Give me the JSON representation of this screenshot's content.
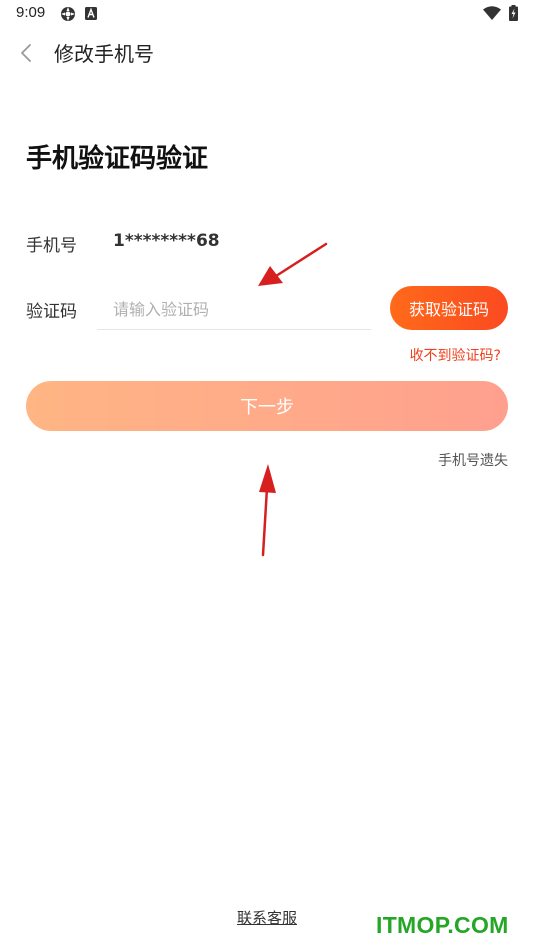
{
  "status_bar": {
    "time": "9:09",
    "icons": [
      "settings-status-icon",
      "a-status-icon",
      "wifi-icon",
      "battery-icon"
    ]
  },
  "nav": {
    "back_icon": "chevron-left-icon",
    "title": "修改手机号"
  },
  "heading": "手机验证码验证",
  "phone": {
    "label": "手机号",
    "value": "1********68"
  },
  "code": {
    "label": "验证码",
    "placeholder": "请输入验证码",
    "value": "",
    "get_code_label": "获取验证码"
  },
  "no_code_link": "收不到验证码?",
  "next_label": "下一步",
  "phone_lost_link": "手机号遗失",
  "contact_link": "联系客服",
  "watermark": "ITMOP.COM",
  "colors": {
    "accent": "#fb4a20",
    "accent_start": "#ff6a1a",
    "next_start": "#ffb584",
    "next_end": "#ffa08e",
    "link_red": "#f0401e",
    "annotation_arrow": "#d71f1f",
    "watermark": "#26a626"
  }
}
